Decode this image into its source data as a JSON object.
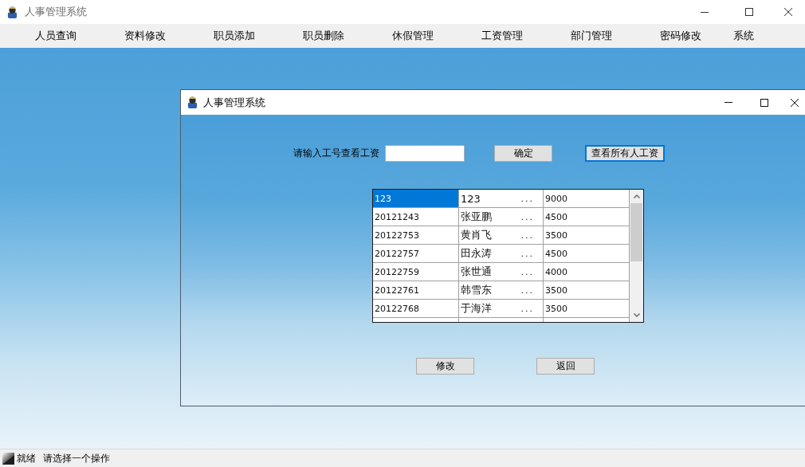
{
  "window": {
    "title": "人事管理系统"
  },
  "menu": [
    "人员查询",
    "资料修改",
    "职员添加",
    "职员删除",
    "休假管理",
    "工资管理",
    "部门管理",
    "密码修改",
    "系统"
  ],
  "dialog": {
    "title": "人事管理系统",
    "query_label": "请输入工号查看工资",
    "buttons": [
      {
        "label": "确定",
        "focused": false
      },
      {
        "label": "查看所有人工资",
        "focused": true
      }
    ],
    "table": {
      "rows": [
        {
          "selected": true,
          "cells": [
            "123",
            "123",
            "9000"
          ],
          "suffix": "..."
        },
        {
          "selected": false,
          "cells": [
            "20121243",
            "张亚鹏",
            "4500"
          ],
          "suffix": "..."
        },
        {
          "selected": false,
          "cells": [
            "20122753",
            "黄肖飞",
            "3500"
          ],
          "suffix": "..."
        },
        {
          "selected": false,
          "cells": [
            "20122757",
            "田永涛",
            "4500"
          ],
          "suffix": "..."
        },
        {
          "selected": false,
          "cells": [
            "20122759",
            "张世通",
            "4000"
          ],
          "suffix": "..."
        },
        {
          "selected": false,
          "cells": [
            "20122761",
            "韩雪东",
            "3500"
          ],
          "suffix": "..."
        },
        {
          "selected": false,
          "cells": [
            "20122768",
            "于海洋",
            "3500"
          ],
          "suffix": "..."
        }
      ]
    },
    "actions": [
      "修改",
      "返回"
    ]
  },
  "status_bar": {
    "items": [
      "就绪",
      "请选择一个操作"
    ]
  }
}
